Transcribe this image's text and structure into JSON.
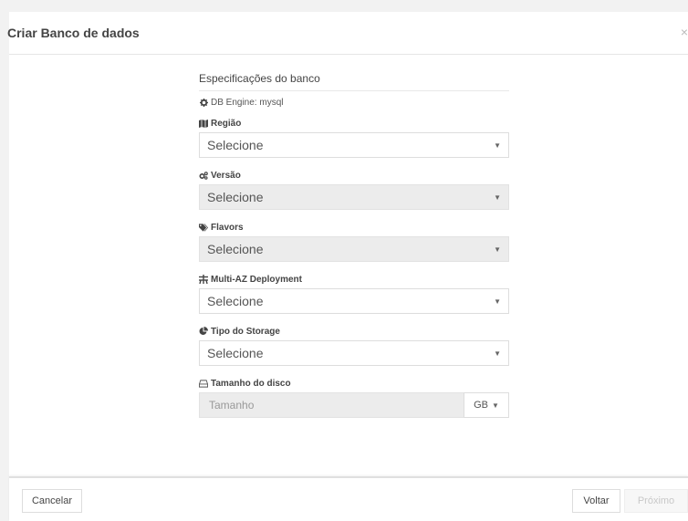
{
  "modal": {
    "title": "Criar Banco de dados",
    "close_glyph": "×"
  },
  "form": {
    "section_title": "Especificações do banco",
    "engine_text": "DB Engine: mysql",
    "engine_icon": "gear-icon",
    "fields": [
      {
        "label": "Região",
        "icon": "map-icon",
        "value": "Selecione",
        "disabled": false
      },
      {
        "label": "Versão",
        "icon": "cogs-icon",
        "value": "Selecione",
        "disabled": true
      },
      {
        "label": "Flavors",
        "icon": "tags-icon",
        "value": "Selecione",
        "disabled": true
      },
      {
        "label": "Multi-AZ Deployment",
        "icon": "fork-icon",
        "value": "Selecione",
        "disabled": false
      },
      {
        "label": "Tipo do Storage",
        "icon": "pie-chart-icon",
        "value": "Selecione",
        "disabled": false
      }
    ],
    "disk": {
      "label": "Tamanho do disco",
      "icon": "hdd-icon",
      "placeholder": "Tamanho",
      "unit": "GB"
    }
  },
  "footer": {
    "cancel_label": "Cancelar",
    "back_label": "Voltar",
    "next_label": "Próximo"
  }
}
